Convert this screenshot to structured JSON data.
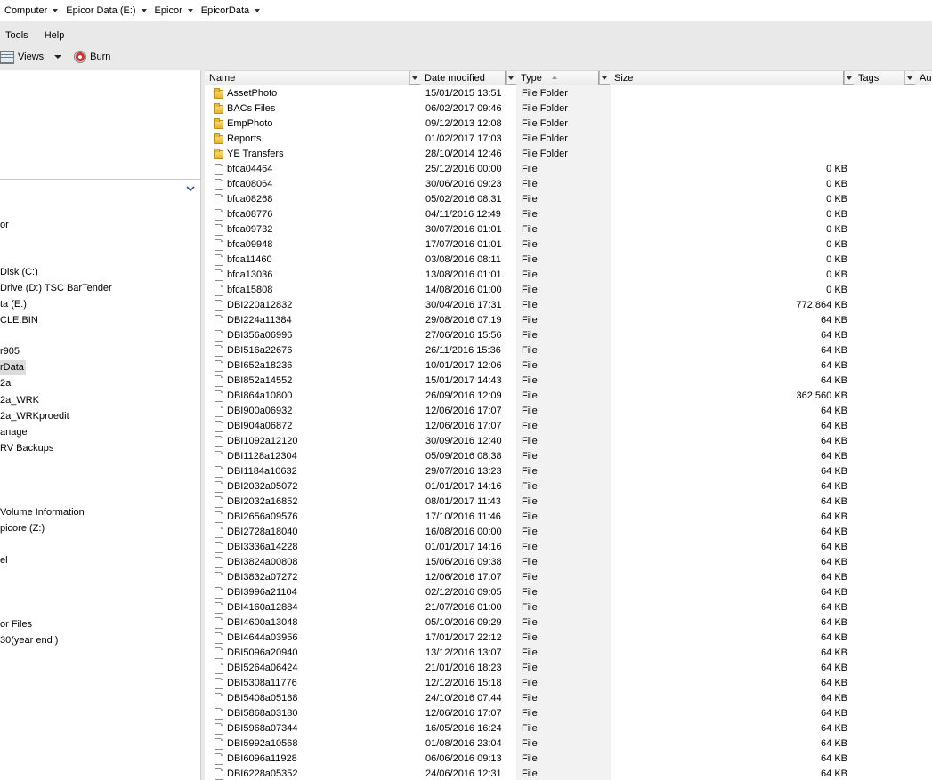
{
  "address": {
    "crumbs": [
      "Computer",
      "Epicor Data (E:)",
      "Epicor",
      "EpicorData"
    ]
  },
  "menu": {
    "items": [
      "Tools",
      "Help"
    ]
  },
  "toolbar": {
    "views_label": "Views",
    "burn_label": "Burn"
  },
  "nav": {
    "items": [
      {
        "label": "or",
        "selected": false
      },
      {
        "label": "Disk (C:)",
        "selected": false
      },
      {
        "label": "Drive (D:) TSC BarTender",
        "selected": false
      },
      {
        "label": "ta (E:)",
        "selected": false
      },
      {
        "label": "CLE.BIN",
        "selected": false
      },
      {
        "label": "r905",
        "selected": false
      },
      {
        "label": "rData",
        "selected": true
      },
      {
        "label": "2a",
        "selected": false
      },
      {
        "label": "2a_WRK",
        "selected": false
      },
      {
        "label": "2a_WRKproedit",
        "selected": false
      },
      {
        "label": "anage",
        "selected": false
      },
      {
        "label": "RV Backups",
        "selected": false
      },
      {
        "label": "Volume Information",
        "selected": false
      },
      {
        "label": "picore (Z:)",
        "selected": false
      },
      {
        "label": "el",
        "selected": false
      },
      {
        "label": "or Files",
        "selected": false
      },
      {
        "label": "30(year end )",
        "selected": false
      }
    ]
  },
  "columns": {
    "name": "Name",
    "date": "Date modified",
    "type": "Type",
    "size": "Size",
    "tags": "Tags",
    "authors": "Au"
  },
  "files": [
    {
      "name": "AssetPhoto",
      "date": "15/01/2015 13:51",
      "type": "File Folder",
      "size": "",
      "icon": "folder-icon"
    },
    {
      "name": "BACs Files",
      "date": "06/02/2017 09:46",
      "type": "File Folder",
      "size": "",
      "icon": "folder-icon"
    },
    {
      "name": "EmpPhoto",
      "date": "09/12/2013 12:08",
      "type": "File Folder",
      "size": "",
      "icon": "folder-icon"
    },
    {
      "name": "Reports",
      "date": "01/02/2017 17:03",
      "type": "File Folder",
      "size": "",
      "icon": "folder-icon"
    },
    {
      "name": "YE Transfers",
      "date": "28/10/2014 12:46",
      "type": "File Folder",
      "size": "",
      "icon": "folder-icon"
    },
    {
      "name": "bfca04464",
      "date": "25/12/2016 00:00",
      "type": "File",
      "size": "0 KB",
      "icon": "file-icon"
    },
    {
      "name": "bfca08064",
      "date": "30/06/2016 09:23",
      "type": "File",
      "size": "0 KB",
      "icon": "file-icon"
    },
    {
      "name": "bfca08268",
      "date": "05/02/2016 08:31",
      "type": "File",
      "size": "0 KB",
      "icon": "file-icon"
    },
    {
      "name": "bfca08776",
      "date": "04/11/2016 12:49",
      "type": "File",
      "size": "0 KB",
      "icon": "file-icon"
    },
    {
      "name": "bfca09732",
      "date": "30/07/2016 01:01",
      "type": "File",
      "size": "0 KB",
      "icon": "file-icon"
    },
    {
      "name": "bfca09948",
      "date": "17/07/2016 01:01",
      "type": "File",
      "size": "0 KB",
      "icon": "file-icon"
    },
    {
      "name": "bfca11460",
      "date": "03/08/2016 08:11",
      "type": "File",
      "size": "0 KB",
      "icon": "file-icon"
    },
    {
      "name": "bfca13036",
      "date": "13/08/2016 01:01",
      "type": "File",
      "size": "0 KB",
      "icon": "file-icon"
    },
    {
      "name": "bfca15808",
      "date": "14/08/2016 01:00",
      "type": "File",
      "size": "0 KB",
      "icon": "file-icon"
    },
    {
      "name": "DBI220a12832",
      "date": "30/04/2016 17:31",
      "type": "File",
      "size": "772,864 KB",
      "icon": "file-icon"
    },
    {
      "name": "DBI224a11384",
      "date": "29/08/2016 07:19",
      "type": "File",
      "size": "64 KB",
      "icon": "file-icon"
    },
    {
      "name": "DBI356a06996",
      "date": "27/06/2016 15:56",
      "type": "File",
      "size": "64 KB",
      "icon": "file-icon"
    },
    {
      "name": "DBI516a22676",
      "date": "26/11/2016 15:36",
      "type": "File",
      "size": "64 KB",
      "icon": "file-icon"
    },
    {
      "name": "DBI652a18236",
      "date": "10/01/2017 12:06",
      "type": "File",
      "size": "64 KB",
      "icon": "file-icon"
    },
    {
      "name": "DBI852a14552",
      "date": "15/01/2017 14:43",
      "type": "File",
      "size": "64 KB",
      "icon": "file-icon"
    },
    {
      "name": "DBI864a10800",
      "date": "26/09/2016 12:09",
      "type": "File",
      "size": "362,560 KB",
      "icon": "file-icon"
    },
    {
      "name": "DBI900a06932",
      "date": "12/06/2016 17:07",
      "type": "File",
      "size": "64 KB",
      "icon": "file-icon"
    },
    {
      "name": "DBI904a06872",
      "date": "12/06/2016 17:07",
      "type": "File",
      "size": "64 KB",
      "icon": "file-icon"
    },
    {
      "name": "DBI1092a12120",
      "date": "30/09/2016 12:40",
      "type": "File",
      "size": "64 KB",
      "icon": "file-icon"
    },
    {
      "name": "DBI1128a12304",
      "date": "05/09/2016 08:38",
      "type": "File",
      "size": "64 KB",
      "icon": "file-icon"
    },
    {
      "name": "DBI1184a10632",
      "date": "29/07/2016 13:23",
      "type": "File",
      "size": "64 KB",
      "icon": "file-icon"
    },
    {
      "name": "DBI2032a05072",
      "date": "01/01/2017 14:16",
      "type": "File",
      "size": "64 KB",
      "icon": "file-icon"
    },
    {
      "name": "DBI2032a16852",
      "date": "08/01/2017 11:43",
      "type": "File",
      "size": "64 KB",
      "icon": "file-icon"
    },
    {
      "name": "DBI2656a09576",
      "date": "17/10/2016 11:46",
      "type": "File",
      "size": "64 KB",
      "icon": "file-icon"
    },
    {
      "name": "DBI2728a18040",
      "date": "16/08/2016 00:00",
      "type": "File",
      "size": "64 KB",
      "icon": "file-icon"
    },
    {
      "name": "DBI3336a14228",
      "date": "01/01/2017 14:16",
      "type": "File",
      "size": "64 KB",
      "icon": "file-icon"
    },
    {
      "name": "DBI3824a00808",
      "date": "15/06/2016 09:38",
      "type": "File",
      "size": "64 KB",
      "icon": "file-icon"
    },
    {
      "name": "DBI3832a07272",
      "date": "12/06/2016 17:07",
      "type": "File",
      "size": "64 KB",
      "icon": "file-icon"
    },
    {
      "name": "DBI3996a21104",
      "date": "02/12/2016 09:05",
      "type": "File",
      "size": "64 KB",
      "icon": "file-icon"
    },
    {
      "name": "DBI4160a12884",
      "date": "21/07/2016 01:00",
      "type": "File",
      "size": "64 KB",
      "icon": "file-icon"
    },
    {
      "name": "DBI4600a13048",
      "date": "05/10/2016 09:29",
      "type": "File",
      "size": "64 KB",
      "icon": "file-icon"
    },
    {
      "name": "DBI4644a03956",
      "date": "17/01/2017 22:12",
      "type": "File",
      "size": "64 KB",
      "icon": "file-icon"
    },
    {
      "name": "DBI5096a20940",
      "date": "13/12/2016 13:07",
      "type": "File",
      "size": "64 KB",
      "icon": "file-icon"
    },
    {
      "name": "DBI5264a06424",
      "date": "21/01/2016 18:23",
      "type": "File",
      "size": "64 KB",
      "icon": "file-icon"
    },
    {
      "name": "DBI5308a11776",
      "date": "12/12/2016 15:18",
      "type": "File",
      "size": "64 KB",
      "icon": "file-icon"
    },
    {
      "name": "DBI5408a05188",
      "date": "24/10/2016 07:44",
      "type": "File",
      "size": "64 KB",
      "icon": "file-icon"
    },
    {
      "name": "DBI5868a03180",
      "date": "12/06/2016 17:07",
      "type": "File",
      "size": "64 KB",
      "icon": "file-icon"
    },
    {
      "name": "DBI5968a07344",
      "date": "16/05/2016 16:24",
      "type": "File",
      "size": "64 KB",
      "icon": "file-icon"
    },
    {
      "name": "DBI5992a10568",
      "date": "01/08/2016 23:04",
      "type": "File",
      "size": "64 KB",
      "icon": "file-icon"
    },
    {
      "name": "DBI6096a11928",
      "date": "06/06/2016 09:13",
      "type": "File",
      "size": "64 KB",
      "icon": "file-icon"
    },
    {
      "name": "DBI6228a05352",
      "date": "24/06/2016 12:31",
      "type": "File",
      "size": "64 KB",
      "icon": "file-icon"
    }
  ]
}
